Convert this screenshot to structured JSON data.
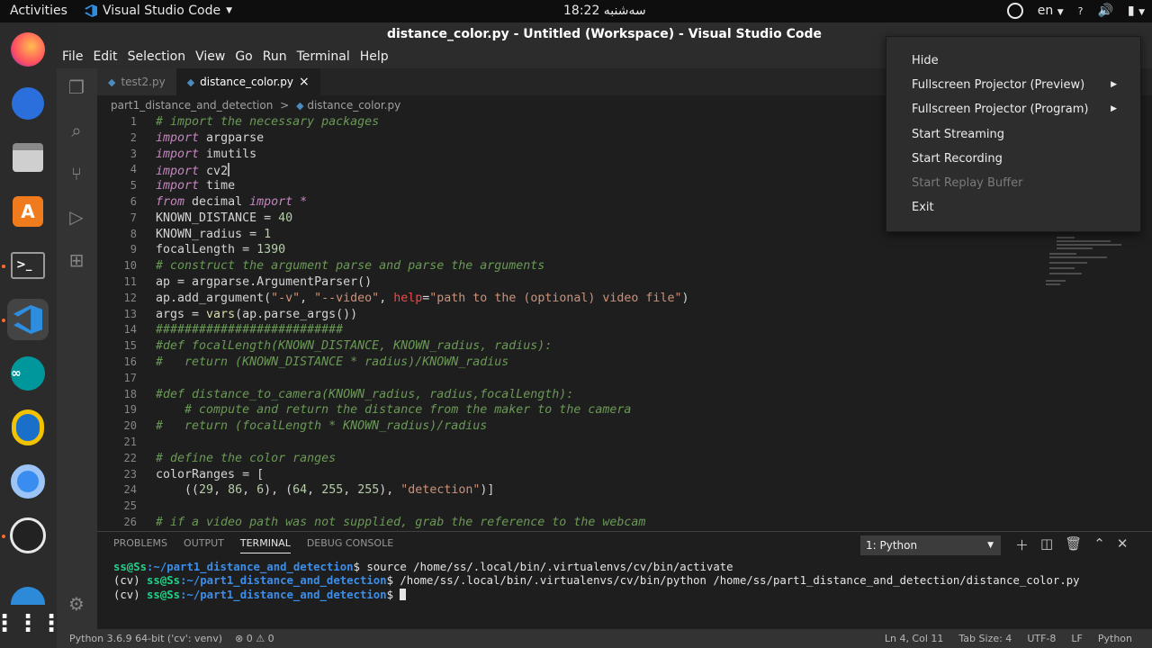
{
  "topbar": {
    "activities": "Activities",
    "app_name": "Visual Studio Code",
    "clock": "18:22 سه‌شنبه",
    "lang": "en",
    "tray_icons": [
      "obs-icon",
      "accessibility-icon",
      "volume-icon",
      "battery-icon"
    ]
  },
  "dock": {
    "apps": [
      "firefox",
      "thunderbird",
      "files",
      "software",
      "terminal",
      "vscode",
      "arduino",
      "tux",
      "chromium",
      "obs",
      "edge",
      "show-apps"
    ]
  },
  "window": {
    "title": "distance_color.py - Untitled (Workspace) - Visual Studio Code"
  },
  "menu": [
    "File",
    "Edit",
    "Selection",
    "View",
    "Go",
    "Run",
    "Terminal",
    "Help"
  ],
  "tabs": [
    {
      "label": "test2.py",
      "active": false
    },
    {
      "label": "distance_color.py",
      "active": true,
      "close": "×"
    }
  ],
  "breadcrumb": {
    "folder": "part1_distance_and_detection",
    "sep": ">",
    "file": "distance_color.py"
  },
  "editor": {
    "lines": [
      {
        "n": "1",
        "text": "# import the necessary packages"
      },
      {
        "n": "2",
        "text": "import argparse"
      },
      {
        "n": "3",
        "text": "import imutils"
      },
      {
        "n": "4",
        "text": "import cv2"
      },
      {
        "n": "5",
        "text": "import time"
      },
      {
        "n": "6",
        "text": "from decimal import *"
      },
      {
        "n": "7",
        "text": "KNOWN_DISTANCE = 40"
      },
      {
        "n": "8",
        "text": "KNOWN_radius = 1"
      },
      {
        "n": "9",
        "text": "focalLength = 1390"
      },
      {
        "n": "10",
        "text": "# construct the argument parse and parse the arguments"
      },
      {
        "n": "11",
        "text": "ap = argparse.ArgumentParser()"
      },
      {
        "n": "12",
        "text": "ap.add_argument(\"-v\", \"--video\", help=\"path to the (optional) video file\")"
      },
      {
        "n": "13",
        "text": "args = vars(ap.parse_args())"
      },
      {
        "n": "14",
        "text": "##########################"
      },
      {
        "n": "15",
        "text": "#def focalLength(KNOWN_DISTANCE, KNOWN_radius, radius):"
      },
      {
        "n": "16",
        "text": "#   return (KNOWN_DISTANCE * radius)/KNOWN_radius"
      },
      {
        "n": "17",
        "text": ""
      },
      {
        "n": "18",
        "text": "#def distance_to_camera(KNOWN_radius, radius,focalLength):"
      },
      {
        "n": "19",
        "text": "    # compute and return the distance from the maker to the camera"
      },
      {
        "n": "20",
        "text": "#   return (focalLength * KNOWN_radius)/radius"
      },
      {
        "n": "21",
        "text": ""
      },
      {
        "n": "22",
        "text": "# define the color ranges"
      },
      {
        "n": "23",
        "text": "colorRanges = ["
      },
      {
        "n": "24",
        "text": "    ((29, 86, 6), (64, 255, 255), \"detection\")]"
      },
      {
        "n": "25",
        "text": ""
      },
      {
        "n": "26",
        "text": "# if a video path was not supplied, grab the reference to the webcam"
      }
    ]
  },
  "context_menu": {
    "items": [
      {
        "label": "Hide",
        "disabled": false,
        "submenu": false
      },
      {
        "label": "Fullscreen Projector (Preview)",
        "disabled": false,
        "submenu": true
      },
      {
        "label": "Fullscreen Projector (Program)",
        "disabled": false,
        "submenu": true
      },
      {
        "label": "Start Streaming",
        "disabled": false,
        "submenu": false
      },
      {
        "label": "Start Recording",
        "disabled": false,
        "submenu": false
      },
      {
        "label": "Start Replay Buffer",
        "disabled": true,
        "submenu": false
      },
      {
        "label": "Exit",
        "disabled": false,
        "submenu": false
      }
    ]
  },
  "panel": {
    "tabs": [
      "PROBLEMS",
      "OUTPUT",
      "TERMINAL",
      "DEBUG CONSOLE"
    ],
    "active_tab": "TERMINAL",
    "terminal_select": "1: Python",
    "terminal": [
      {
        "prefix": "",
        "user": "ss@Ss",
        "path": ":~/part1_distance_and_detection",
        "cmd": "$ source /home/ss/.local/bin/.virtualenvs/cv/bin/activate"
      },
      {
        "prefix": "(cv) ",
        "user": "ss@Ss",
        "path": ":~/part1_distance_and_detection",
        "cmd": "$ /home/ss/.local/bin/.virtualenvs/cv/bin/python /home/ss/part1_distance_and_detection/distance_color.py"
      },
      {
        "prefix": "(cv) ",
        "user": "ss@Ss",
        "path": ":~/part1_distance_and_detection",
        "cmd": "$ "
      }
    ]
  },
  "statusbar": {
    "interpreter": "Python 3.6.9 64-bit ('cv': venv)",
    "problems": "⊗ 0 ⚠ 0",
    "position": "Ln 4, Col 11",
    "tab_size": "Tab Size: 4",
    "encoding": "UTF-8",
    "eol": "LF",
    "language": "Python"
  },
  "colors": {
    "accent": "#007acc",
    "editor_bg": "#1e1e1e",
    "keyword": "#c586c0",
    "comment": "#6a9955",
    "string": "#ce9178",
    "number": "#b5cea8"
  }
}
